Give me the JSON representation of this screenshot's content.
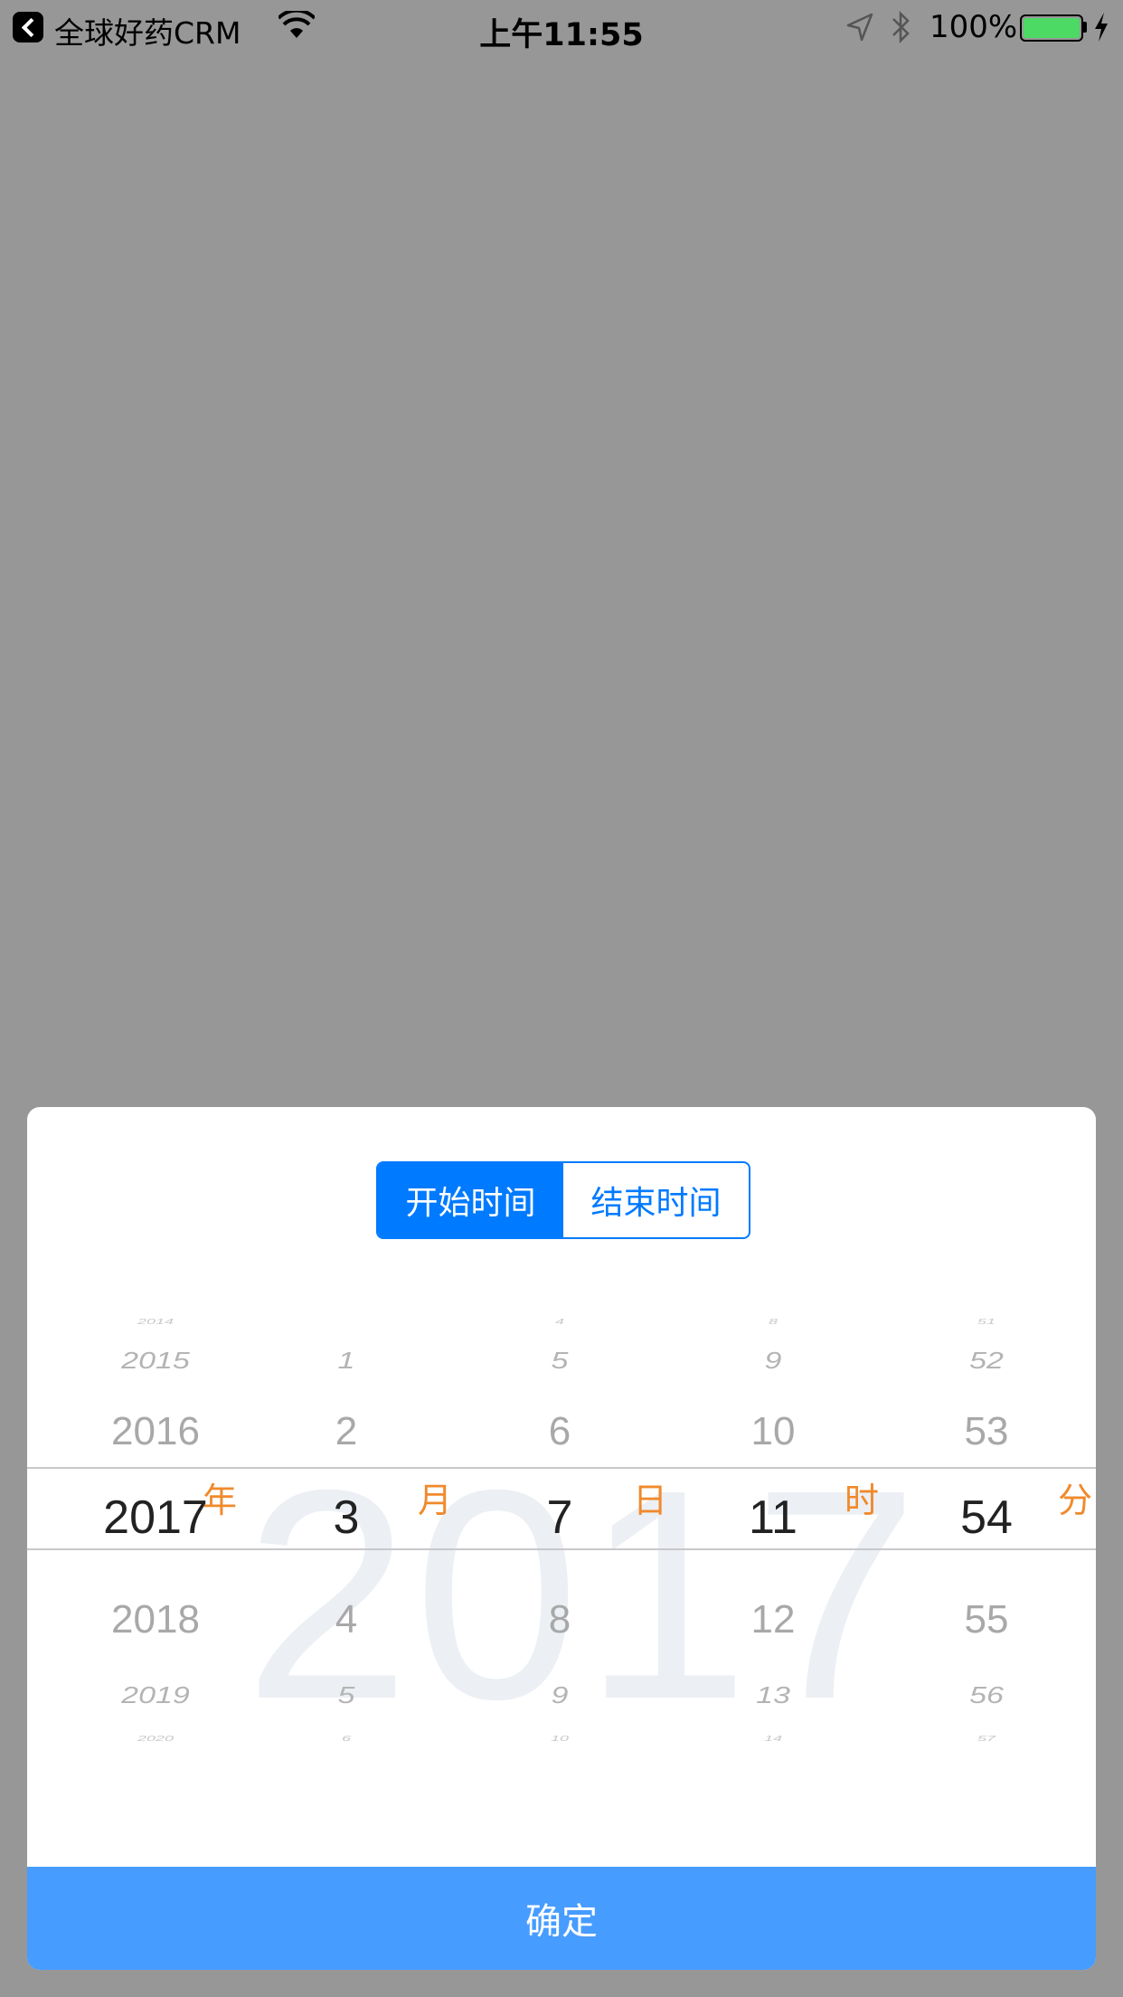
{
  "status_bar": {
    "app_name": "全球好药CRM",
    "time": "上午11:55",
    "battery_percent": "100%",
    "battery_color": "#4cd964"
  },
  "picker": {
    "tabs": [
      {
        "label": "开始时间",
        "active": true
      },
      {
        "label": "结束时间",
        "active": false
      }
    ],
    "watermark": "2017",
    "columns": [
      {
        "unit": "年",
        "values": [
          "2014",
          "2015",
          "2016",
          "2017",
          "2018",
          "2019",
          "2020"
        ]
      },
      {
        "unit": "月",
        "values": [
          "",
          "1",
          "2",
          "3",
          "4",
          "5",
          "6"
        ]
      },
      {
        "unit": "日",
        "values": [
          "4",
          "5",
          "6",
          "7",
          "8",
          "9",
          "10"
        ]
      },
      {
        "unit": "时",
        "values": [
          "8",
          "9",
          "10",
          "11",
          "12",
          "13",
          "14"
        ]
      },
      {
        "unit": "分",
        "values": [
          "51",
          "52",
          "53",
          "54",
          "55",
          "56",
          "57"
        ]
      }
    ],
    "confirm_label": "确定",
    "accent_color": "#007aff",
    "unit_color": "#f08a2c"
  }
}
